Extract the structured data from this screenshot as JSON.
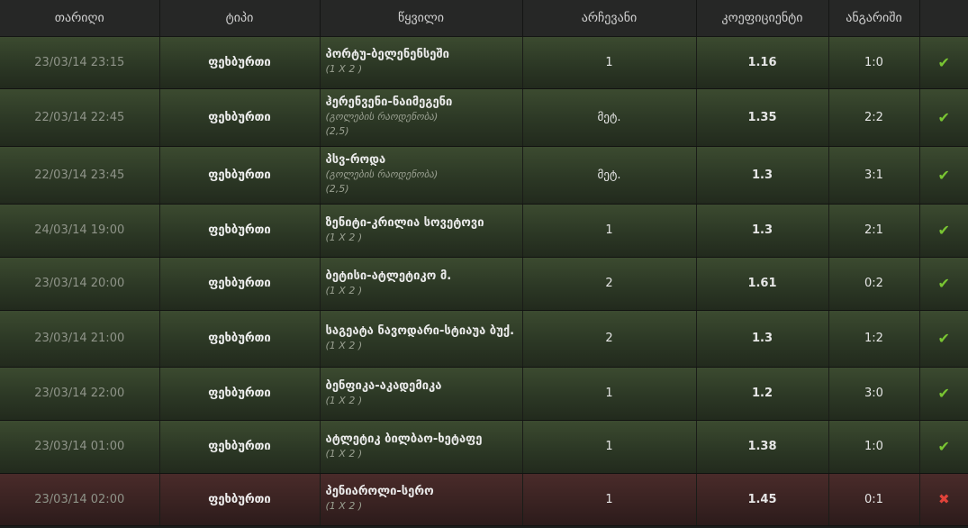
{
  "header": {
    "date": "თარიღი",
    "type": "ტიპი",
    "event": "წყვილი",
    "choice": "არჩევანი",
    "odds": "კოეფიციენტი",
    "score": "ანგარიში"
  },
  "rows": [
    {
      "date": "23/03/14 23:15",
      "type": "ფეხბურთი",
      "event": "პორტუ-ბელენენსეში",
      "market": "(1 X 2 )",
      "line": "",
      "choice": "1",
      "odds": "1.16",
      "score": "1:0",
      "result": "won",
      "status_icon": "check-icon"
    },
    {
      "date": "22/03/14 22:45",
      "type": "ფეხბურთი",
      "event": "ჰერენვენი-ნაიმეგენი",
      "market": "(გოლების რაოდენობა)",
      "line": "(2,5)",
      "choice": "მეტ.",
      "odds": "1.35",
      "score": "2:2",
      "result": "won",
      "status_icon": "check-icon"
    },
    {
      "date": "22/03/14 23:45",
      "type": "ფეხბურთი",
      "event": "პსვ-როდა",
      "market": "(გოლების რაოდენობა)",
      "line": "(2,5)",
      "choice": "მეტ.",
      "odds": "1.3",
      "score": "3:1",
      "result": "won",
      "status_icon": "check-icon"
    },
    {
      "date": "24/03/14 19:00",
      "type": "ფეხბურთი",
      "event": "ზენიტი-კრილია სოვეტოვი",
      "market": "(1 X 2 )",
      "line": "",
      "choice": "1",
      "odds": "1.3",
      "score": "2:1",
      "result": "won",
      "status_icon": "check-icon"
    },
    {
      "date": "23/03/14 20:00",
      "type": "ფეხბურთი",
      "event": "ბეტისი-ატლეტიკო მ.",
      "market": "(1 X 2 )",
      "line": "",
      "choice": "2",
      "odds": "1.61",
      "score": "0:2",
      "result": "won",
      "status_icon": "check-icon"
    },
    {
      "date": "23/03/14 21:00",
      "type": "ფეხბურთი",
      "event": "საგეატა ნავოდარი-სტიაუა ბუქ.",
      "market": "(1 X 2 )",
      "line": "",
      "choice": "2",
      "odds": "1.3",
      "score": "1:2",
      "result": "won",
      "status_icon": "check-icon"
    },
    {
      "date": "23/03/14 22:00",
      "type": "ფეხბურთი",
      "event": "ბენფიკა-აკადემიკა",
      "market": "(1 X 2 )",
      "line": "",
      "choice": "1",
      "odds": "1.2",
      "score": "3:0",
      "result": "won",
      "status_icon": "check-icon"
    },
    {
      "date": "23/03/14 01:00",
      "type": "ფეხბურთი",
      "event": "ატლეტიკ ბილბაო-ხეტაფე",
      "market": "(1 X 2 )",
      "line": "",
      "choice": "1",
      "odds": "1.38",
      "score": "1:0",
      "result": "won",
      "status_icon": "check-icon"
    },
    {
      "date": "23/03/14 02:00",
      "type": "ფეხბურთი",
      "event": "პენიაროლი-სერო",
      "market": "(1 X 2 )",
      "line": "",
      "choice": "1",
      "odds": "1.45",
      "score": "0:1",
      "result": "lost",
      "status_icon": "cross-icon"
    }
  ],
  "colors": {
    "won_row": "#2f3b27",
    "lost_row": "#3d2524",
    "check": "#79c532",
    "cross": "#e0433a"
  }
}
